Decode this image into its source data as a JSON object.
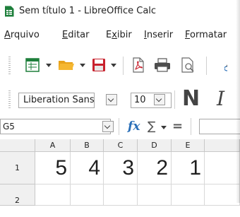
{
  "window": {
    "title": "Sem título 1 - LibreOffice Calc"
  },
  "menu": [
    {
      "label": "Arquivo"
    },
    {
      "label": "Editar"
    },
    {
      "label": "Exibir"
    },
    {
      "label": "Inserir"
    },
    {
      "label": "Formatar"
    }
  ],
  "toolbar": {
    "icons": [
      "new-spreadsheet-icon",
      "open-folder-icon",
      "save-icon",
      "export-pdf-icon",
      "print-icon",
      "print-preview-icon"
    ]
  },
  "formatting": {
    "font_name": "Liberation Sans",
    "font_size": "10",
    "bold_label": "N",
    "italic_label": "I"
  },
  "formula_bar": {
    "name_box": "G5",
    "fx_label": "fx",
    "sigma_label": "∑",
    "equals_label": "="
  },
  "sheet": {
    "columns": [
      "A",
      "B",
      "C",
      "D",
      "E"
    ],
    "rows": [
      "1",
      "2"
    ],
    "row1_values": [
      "5",
      "4",
      "3",
      "2",
      "1"
    ]
  },
  "colors": {
    "calc_green": "#1e7f3b",
    "folder_yellow": "#f5b731",
    "save_red": "#c8212d",
    "fx_blue": "#2a6fb8"
  }
}
